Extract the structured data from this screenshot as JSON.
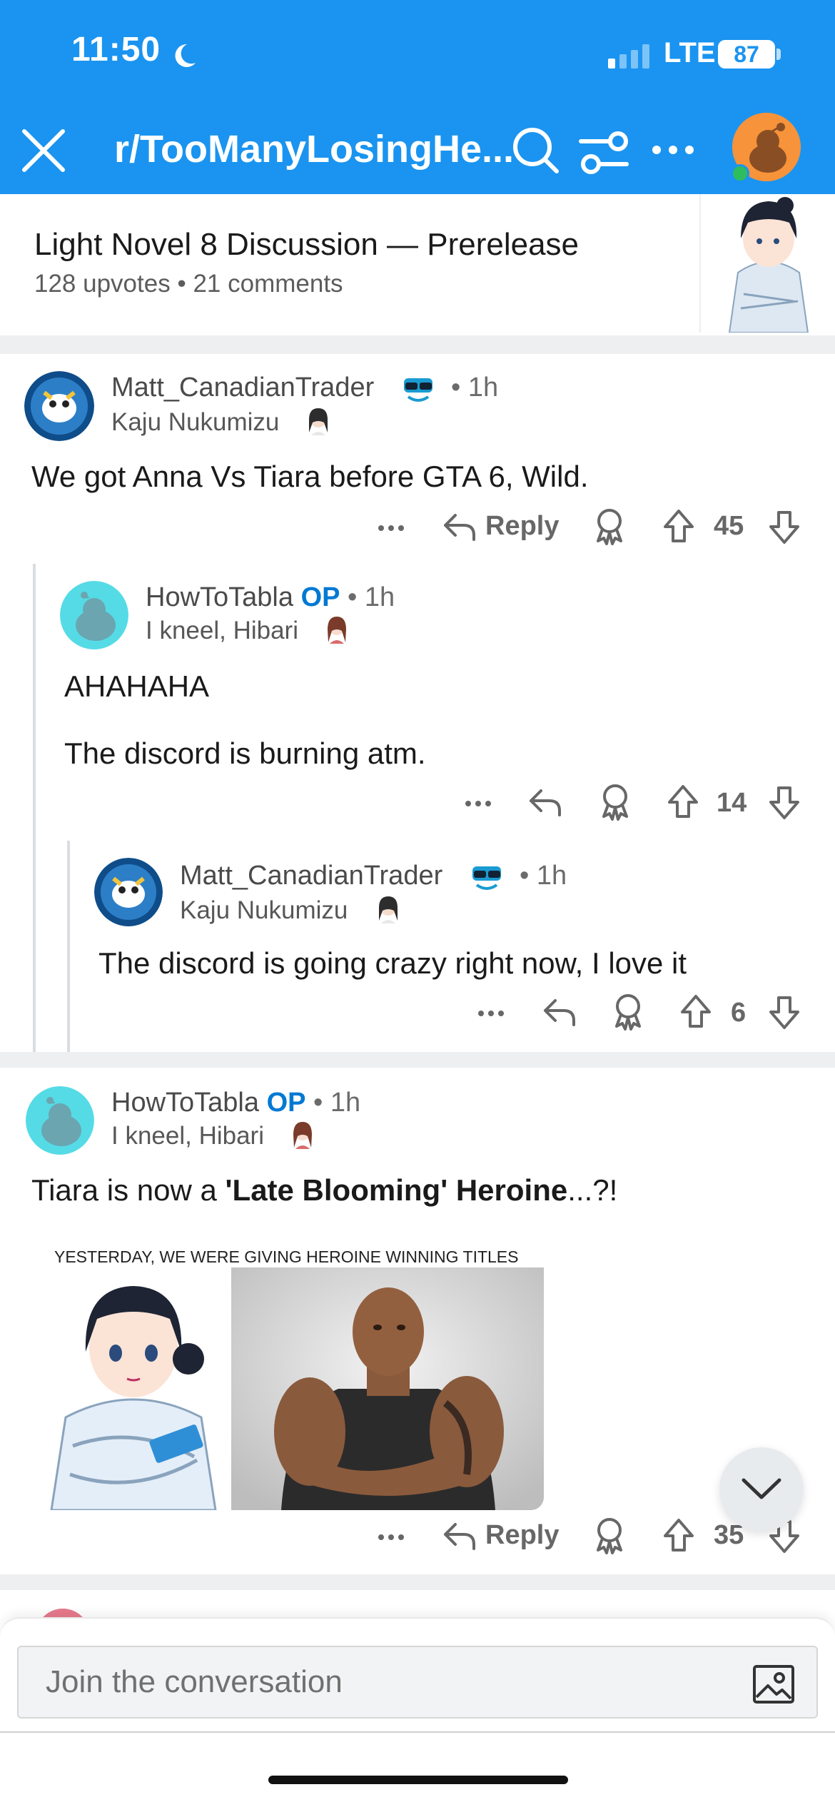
{
  "status_bar": {
    "time": "11:50",
    "network": "LTE",
    "battery": "87"
  },
  "nav": {
    "title": "r/TooManyLosingHe...",
    "brand_color": "#1A94F0"
  },
  "post": {
    "title": "Light Novel 8 Discussion — Prerelease",
    "upvotes": "128 upvotes",
    "separator": "•",
    "comments": "21 comments"
  },
  "comments": [
    {
      "username": "Matt_CanadianTrader",
      "age": "• 1h",
      "flair": "Kaju Nukumizu",
      "body": "We got Anna Vs Tiara before GTA 6, Wild.",
      "reply_label": "Reply",
      "score": "45"
    },
    {
      "username": "HowToTabla",
      "op_label": "OP",
      "age": "• 1h",
      "flair": "I kneel, Hibari",
      "body_line1": "AHAHAHA",
      "body_line2": "The discord is burning atm.",
      "score": "14"
    },
    {
      "username": "Matt_CanadianTrader",
      "age": "• 1h",
      "flair": "Kaju Nukumizu",
      "body": "The discord is going crazy right now, I love it",
      "score": "6"
    },
    {
      "username": "HowToTabla",
      "op_label": "OP",
      "age": "• 1h",
      "flair": "I kneel, Hibari",
      "body_pre": "Tiara is now a ",
      "body_bold": "'Late Blooming' Heroine",
      "body_post": "...?!",
      "meme_caption": "YESTERDAY, WE WERE GIVING HEROINE WINNING TITLES",
      "reply_label": "Reply",
      "score": "35"
    }
  ],
  "composer": {
    "placeholder": "Join the conversation"
  },
  "icons": {
    "close": "close-icon",
    "search": "search-icon",
    "filter": "filter-icon",
    "more": "more-icon",
    "reply": "reply-arrow-icon",
    "award": "award-icon",
    "upvote": "upvote-icon",
    "downvote": "downvote-icon",
    "scroll": "chevron-down-icon",
    "image": "image-icon"
  }
}
